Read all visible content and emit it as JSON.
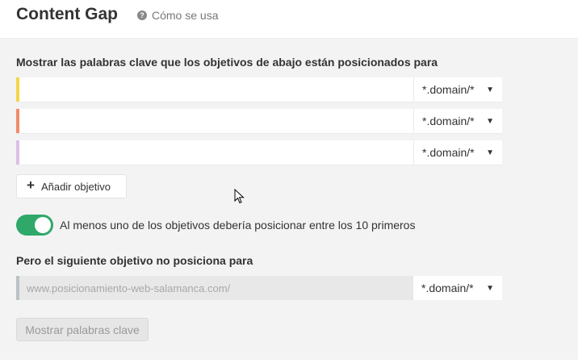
{
  "header": {
    "title": "Content Gap",
    "help_label": "Cómo se usa",
    "help_icon": "question-circle-icon"
  },
  "targets_section": {
    "label": "Mostrar las palabras clave que los objetivos de abajo están posicionados para",
    "rows": [
      {
        "value": "",
        "mode": "*.domain/*",
        "color": "#f5d547"
      },
      {
        "value": "",
        "mode": "*.domain/*",
        "color": "#f28b6b"
      },
      {
        "value": "",
        "mode": "*.domain/*",
        "color": "#dcbfe8"
      }
    ],
    "add_button_label": "Añadir objetivo"
  },
  "toggle": {
    "on": true,
    "label": "Al menos uno de los objetivos debería posicionar entre los 10 primeros",
    "color": "#2fa86a"
  },
  "exclude_section": {
    "label": "Pero el siguiente objetivo no posiciona para",
    "placeholder": "www.posicionamiento-web-salamanca.com/",
    "mode": "*.domain/*"
  },
  "submit_button_label": "Mostrar palabras clave"
}
